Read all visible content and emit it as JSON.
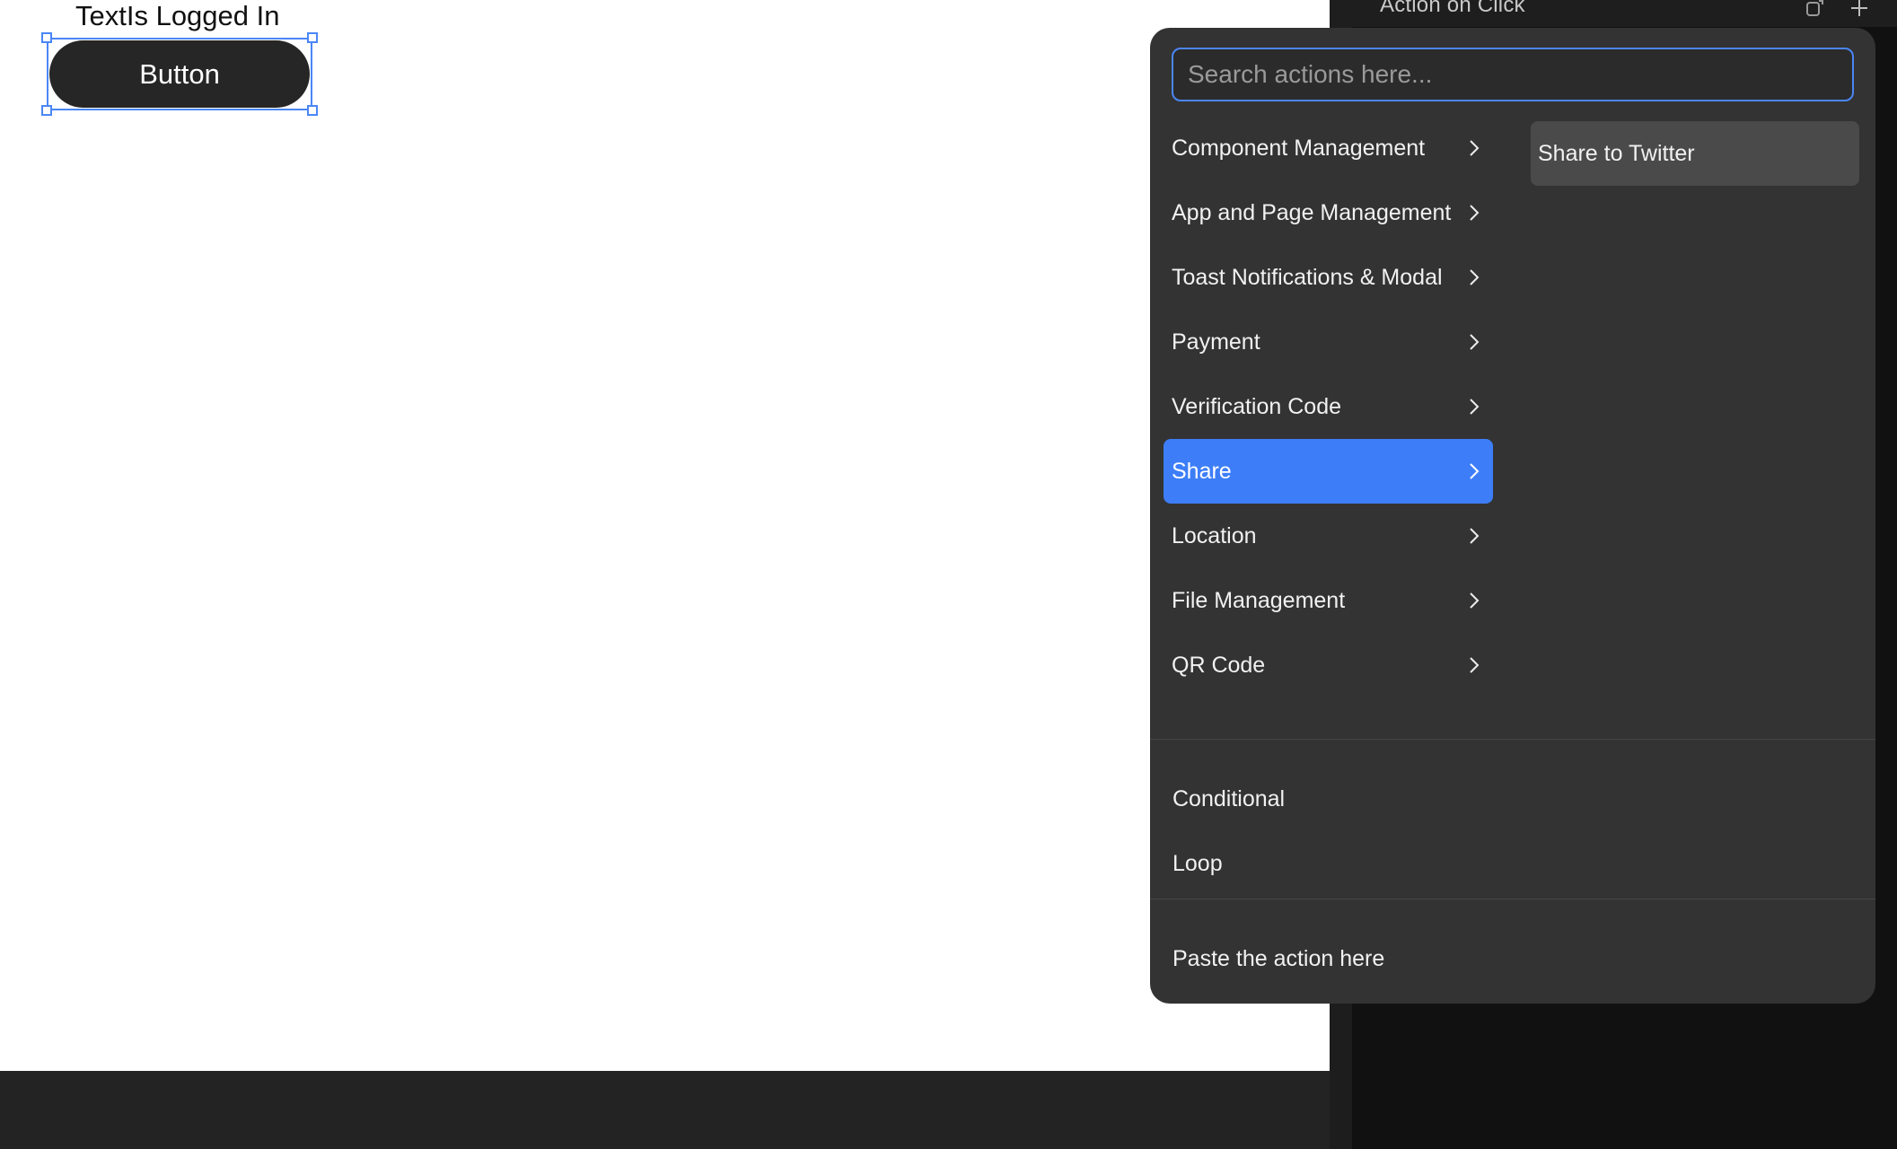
{
  "canvas": {
    "text_label": "TextIs Logged In",
    "button_label": "Button"
  },
  "panel": {
    "title": "Action on Click",
    "icons": [
      "copy-icon",
      "add-icon"
    ]
  },
  "popup": {
    "search_placeholder": "Search actions here...",
    "categories": [
      {
        "label": "Component Management"
      },
      {
        "label": "App and Page Management"
      },
      {
        "label": "Toast Notifications & Modal"
      },
      {
        "label": "Payment"
      },
      {
        "label": "Verification Code"
      },
      {
        "label": "Share"
      },
      {
        "label": "Location"
      },
      {
        "label": "File Management"
      },
      {
        "label": "QR Code"
      }
    ],
    "selected_category": "Share",
    "sub_actions": [
      {
        "label": "Share to Twitter"
      }
    ],
    "flow_items": [
      {
        "label": "Conditional"
      },
      {
        "label": "Loop"
      }
    ],
    "paste_label": "Paste the action here"
  },
  "colors": {
    "accent": "#3d7ef8",
    "selection": "#4a86f5",
    "popup_bg": "#333333"
  }
}
